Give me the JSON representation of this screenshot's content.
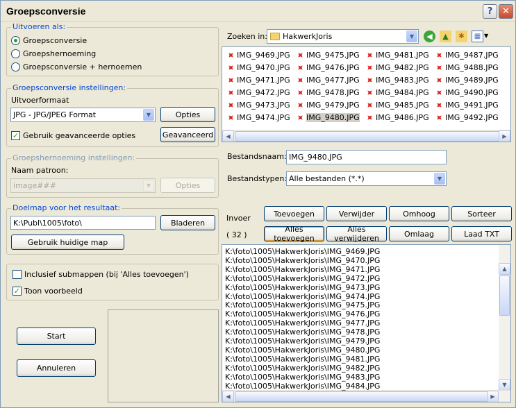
{
  "window": {
    "title": "Groepsconversie"
  },
  "output_as": {
    "title": "Uitvoeren als:",
    "options": [
      "Groepsconversie",
      "Groepshernoeming",
      "Groepsconversie + hernoemen"
    ],
    "selected": 0
  },
  "conversion": {
    "title": "Groepsconversie instellingen:",
    "format_label": "Uitvoerformaat",
    "format_value": "JPG - JPG/JPEG Format",
    "options_button": "Opties",
    "advanced_checkbox": "Gebruik geavanceerde opties",
    "advanced_button": "Geavanceerd"
  },
  "rename": {
    "title": "Groepshernoeming instellingen:",
    "pattern_label": "Naam patroon:",
    "pattern_value": "image###",
    "options_button": "Opties"
  },
  "target": {
    "title": "Doelmap voor het resultaat:",
    "path": "K:\\Publ\\1005\\foto\\",
    "browse_button": "Bladeren",
    "current_button": "Gebruik huidige map"
  },
  "include_subfolders": "Inclusief submappen (bij 'Alles toevoegen')",
  "show_preview": "Toon voorbeeld",
  "start_button": "Start",
  "cancel_button": "Annuleren",
  "browser": {
    "search_label": "Zoeken in:",
    "folder": "HakwerkJoris",
    "files": [
      [
        "IMG_9469.JPG",
        "IMG_9470.JPG",
        "IMG_9471.JPG",
        "IMG_9472.JPG",
        "IMG_9473.JPG",
        "IMG_9474.JPG"
      ],
      [
        "IMG_9475.JPG",
        "IMG_9476.JPG",
        "IMG_9477.JPG",
        "IMG_9478.JPG",
        "IMG_9479.JPG",
        "IMG_9480.JPG"
      ],
      [
        "IMG_9481.JPG",
        "IMG_9482.JPG",
        "IMG_9483.JPG",
        "IMG_9484.JPG",
        "IMG_9485.JPG",
        "IMG_9486.JPG"
      ],
      [
        "IMG_9487.JPG",
        "IMG_9488.JPG",
        "IMG_9489.JPG",
        "IMG_9490.JPG",
        "IMG_9491.JPG",
        "IMG_9492.JPG"
      ]
    ],
    "selected_file": "IMG_9480.JPG",
    "filename_label": "Bestandsnaam:",
    "filename_value": "IMG_9480.JPG",
    "filetype_label": "Bestandstypen:",
    "filetype_value": "Alle bestanden (*.*)"
  },
  "input": {
    "label": "Invoer",
    "count": "( 32 )",
    "buttons_row1": [
      "Toevoegen",
      "Verwijder",
      "Omhoog",
      "Sorteer"
    ],
    "buttons_row2": [
      "Alles toevoegen",
      "Alles verwijderen",
      "Omlaag",
      "Laad TXT"
    ],
    "list": [
      "K:\\foto\\1005\\HakwerkJoris\\IMG_9469.JPG",
      "K:\\foto\\1005\\HakwerkJoris\\IMG_9470.JPG",
      "K:\\foto\\1005\\HakwerkJoris\\IMG_9471.JPG",
      "K:\\foto\\1005\\HakwerkJoris\\IMG_9472.JPG",
      "K:\\foto\\1005\\HakwerkJoris\\IMG_9473.JPG",
      "K:\\foto\\1005\\HakwerkJoris\\IMG_9474.JPG",
      "K:\\foto\\1005\\HakwerkJoris\\IMG_9475.JPG",
      "K:\\foto\\1005\\HakwerkJoris\\IMG_9476.JPG",
      "K:\\foto\\1005\\HakwerkJoris\\IMG_9477.JPG",
      "K:\\foto\\1005\\HakwerkJoris\\IMG_9478.JPG",
      "K:\\foto\\1005\\HakwerkJoris\\IMG_9479.JPG",
      "K:\\foto\\1005\\HakwerkJoris\\IMG_9480.JPG",
      "K:\\foto\\1005\\HakwerkJoris\\IMG_9481.JPG",
      "K:\\foto\\1005\\HakwerkJoris\\IMG_9482.JPG",
      "K:\\foto\\1005\\HakwerkJoris\\IMG_9483.JPG",
      "K:\\foto\\1005\\HakwerkJoris\\IMG_9484.JPG"
    ]
  }
}
